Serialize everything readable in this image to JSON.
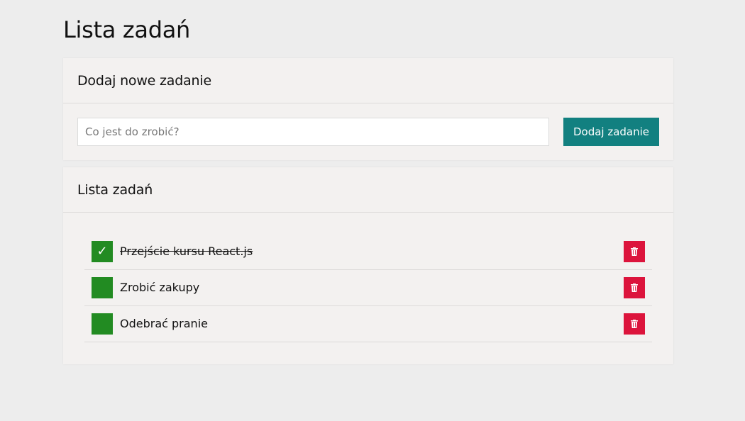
{
  "page": {
    "title": "Lista zadań"
  },
  "add_section": {
    "heading": "Dodaj nowe zadanie",
    "input_value": "",
    "input_placeholder": "Co jest do zrobić?",
    "button_label": "Dodaj zadanie"
  },
  "list_section": {
    "heading": "Lista zadań",
    "tasks": [
      {
        "text": "Przejście kursu React.js",
        "done": true,
        "check_glyph": "✓"
      },
      {
        "text": "Zrobić zakupy",
        "done": false,
        "check_glyph": ""
      },
      {
        "text": "Odebrać pranie",
        "done": false,
        "check_glyph": ""
      }
    ]
  },
  "icons": {
    "checkbox": "check-icon",
    "delete": "trash-icon"
  },
  "colors": {
    "background": "#ededed",
    "card": "#f3f1f0",
    "accent": "#128080",
    "checkbox": "#228b22",
    "delete": "#dc143c"
  }
}
